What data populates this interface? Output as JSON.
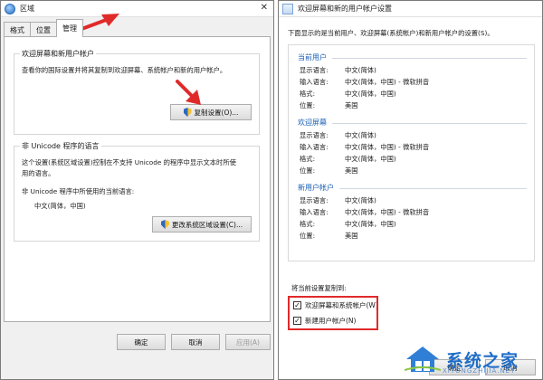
{
  "left_window": {
    "title": "区域",
    "tabs": [
      {
        "label": "格式",
        "active": false
      },
      {
        "label": "位置",
        "active": false
      },
      {
        "label": "管理",
        "active": true
      }
    ],
    "welcome_group": {
      "title": "欢迎屏幕和新用户帐户",
      "description": "查看你的国际设置并将其复制到欢迎屏幕、系统帐户和新的用户帐户。",
      "copy_button": "复制设置(O)..."
    },
    "unicode_group": {
      "title": "非 Unicode 程序的语言",
      "description_line1": "这个设置(系统区域设置)控制在不支持 Unicode 的程序中显示文本时所使",
      "description_line2": "用的语言。",
      "current_label": "非 Unicode 程序中所使用的当前语言:",
      "current_value": "中文(简体，中国)",
      "change_button": "更改系统区域设置(C)..."
    },
    "footer": {
      "ok": "确定",
      "cancel": "取消",
      "apply": "应用(A)"
    }
  },
  "right_window": {
    "title": "欢迎屏幕和新的用户帐户设置",
    "intro": "下面显示的是当前用户、欢迎屏幕(系统帐户)和新用户帐户的设置(S)。",
    "sections": [
      {
        "heading": "当前用户",
        "rows": [
          {
            "label": "显示语言:",
            "value": "中文(简体)"
          },
          {
            "label": "输入语言:",
            "value": "中文(简体，中国) - 微软拼音"
          },
          {
            "label": "格式:",
            "value": "中文(简体，中国)"
          },
          {
            "label": "位置:",
            "value": "美国"
          }
        ]
      },
      {
        "heading": "欢迎屏幕",
        "rows": [
          {
            "label": "显示语言:",
            "value": "中文(简体)"
          },
          {
            "label": "输入语言:",
            "value": "中文(简体，中国) - 微软拼音"
          },
          {
            "label": "格式:",
            "value": "中文(简体，中国)"
          },
          {
            "label": "位置:",
            "value": "美国"
          }
        ]
      },
      {
        "heading": "新用户帐户",
        "rows": [
          {
            "label": "显示语言:",
            "value": "中文(简体)"
          },
          {
            "label": "输入语言:",
            "value": "中文(简体，中国) - 微软拼音"
          },
          {
            "label": "格式:",
            "value": "中文(简体，中国)"
          },
          {
            "label": "位置:",
            "value": "美国"
          }
        ]
      }
    ],
    "copy_to_label": "将当前设置复制到:",
    "checkboxes": [
      {
        "label": "欢迎屏幕和系统帐户(W)",
        "checked": true
      },
      {
        "label": "新建用户帐户(N)",
        "checked": true
      }
    ],
    "footer_partial": {
      "ok": "确定",
      "cancel": "取消"
    }
  },
  "watermark": {
    "text": "系统之家",
    "subtext": "XITONGZHIJIA.NET"
  },
  "colors": {
    "accent": "#1a5fb4",
    "highlight": "#e02a2a",
    "watermark": "#1f6dc7"
  }
}
